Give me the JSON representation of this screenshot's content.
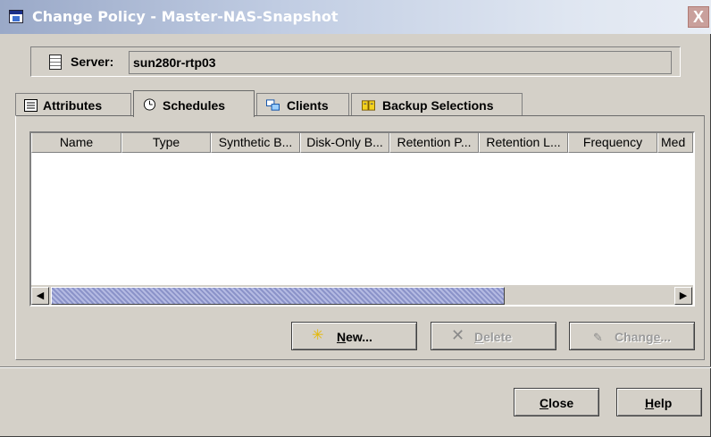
{
  "window": {
    "title": "Change Policy - Master-NAS-Snapshot",
    "close_glyph": "X"
  },
  "server": {
    "label": "Server:",
    "value": "sun280r-rtp03",
    "icon": "server-icon"
  },
  "tabs": [
    {
      "label": "Attributes",
      "icon": "attributes-icon",
      "active": false
    },
    {
      "label": "Schedules",
      "icon": "schedules-icon",
      "active": true
    },
    {
      "label": "Clients",
      "icon": "clients-icon",
      "active": false
    },
    {
      "label": "Backup Selections",
      "icon": "backup-selections-icon",
      "active": false
    }
  ],
  "schedules_table": {
    "columns": [
      "Name",
      "Type",
      "Synthetic B...",
      "Disk-Only B...",
      "Retention P...",
      "Retention L...",
      "Frequency",
      "Med"
    ],
    "rows": []
  },
  "actions": {
    "new_label": "New...",
    "new_mnemonic": "N",
    "delete_label": "Delete",
    "delete_mnemonic": "D",
    "change_label": "Change...",
    "change_mnemonic": "e"
  },
  "footer": {
    "close_label": "Close",
    "help_label": "Help"
  },
  "colors": {
    "dialog_bg": "#d4d0c8",
    "title_gradient_start": "#9aa9c8",
    "scroll_thumb": "#8b93c9"
  }
}
